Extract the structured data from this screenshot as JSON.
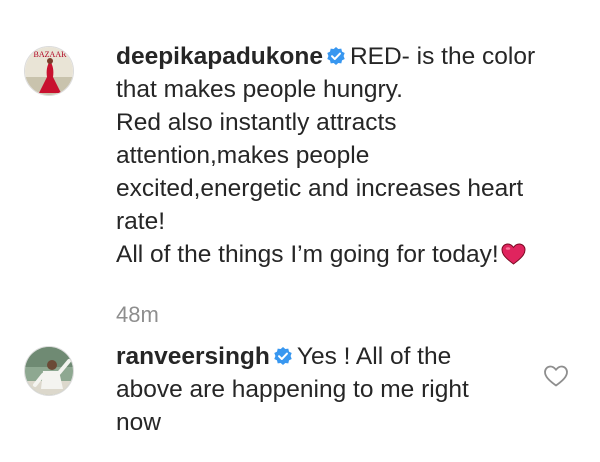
{
  "comments": [
    {
      "username": "deepikapadukone",
      "avatar_text": "BAZAAR",
      "avatar_icon": "magazine-cover-avatar",
      "verified_icon": "verified-badge-icon",
      "lines": [
        "RED- is the color",
        "that makes people hungry.",
        "Red also instantly attracts",
        "attention,makes people",
        "excited,energetic and increases heart",
        "rate!",
        "All of the things I’m going for today!"
      ],
      "emoji_icon": "red-heart-icon",
      "timestamp": "48m"
    },
    {
      "username": "ranveersingh",
      "avatar_icon": "profile-photo-avatar",
      "verified_icon": "verified-badge-icon",
      "lines": [
        "Yes ! All of the",
        "above are happening to me right",
        "now"
      ],
      "like_icon": "heart-outline-icon"
    }
  ],
  "colors": {
    "text": "#262626",
    "muted": "#8e8e8e",
    "verified": "#3897f0",
    "heart": "#e0245e"
  }
}
